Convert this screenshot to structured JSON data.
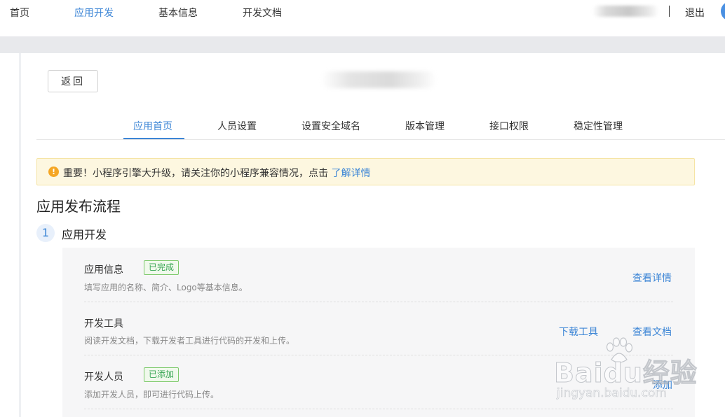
{
  "topnav": {
    "items": [
      {
        "label": "首页",
        "active": false
      },
      {
        "label": "应用开发",
        "active": true
      },
      {
        "label": "基本信息",
        "active": false
      },
      {
        "label": "开发文档",
        "active": false
      }
    ],
    "logout": "退出"
  },
  "back_button": "返回",
  "tabs": [
    {
      "label": "应用首页",
      "active": true
    },
    {
      "label": "人员设置",
      "active": false
    },
    {
      "label": "设置安全域名",
      "active": false
    },
    {
      "label": "版本管理",
      "active": false
    },
    {
      "label": "接口权限",
      "active": false
    },
    {
      "label": "稳定性管理",
      "active": false
    }
  ],
  "notice": {
    "icon": "warning-icon",
    "text": "重要！小程序引擎大升级，请关注你的小程序兼容情况，点击",
    "link": "了解详情"
  },
  "section_title": "应用发布流程",
  "step": {
    "number": "1",
    "title": "应用开发"
  },
  "rows": [
    {
      "title": "应用信息",
      "badge": "已完成",
      "desc": "填写应用的名称、简介、Logo等基本信息。",
      "actions": [
        "查看详情"
      ]
    },
    {
      "title": "开发工具",
      "badge": "",
      "desc": "阅读开发文档，下载开发者工具进行代码的开发和上传。",
      "actions": [
        "下载工具",
        "查看文档"
      ]
    },
    {
      "title": "开发人员",
      "badge": "已添加",
      "desc": "添加开发人员，即可进行代码上传。",
      "actions": [
        "添加"
      ]
    }
  ],
  "watermark": {
    "main": "Baidu经验",
    "sub": "jingyan.baidu.com"
  },
  "colors": {
    "accent": "#3d86d6",
    "success": "#3aa655",
    "warning": "#f5a623"
  }
}
